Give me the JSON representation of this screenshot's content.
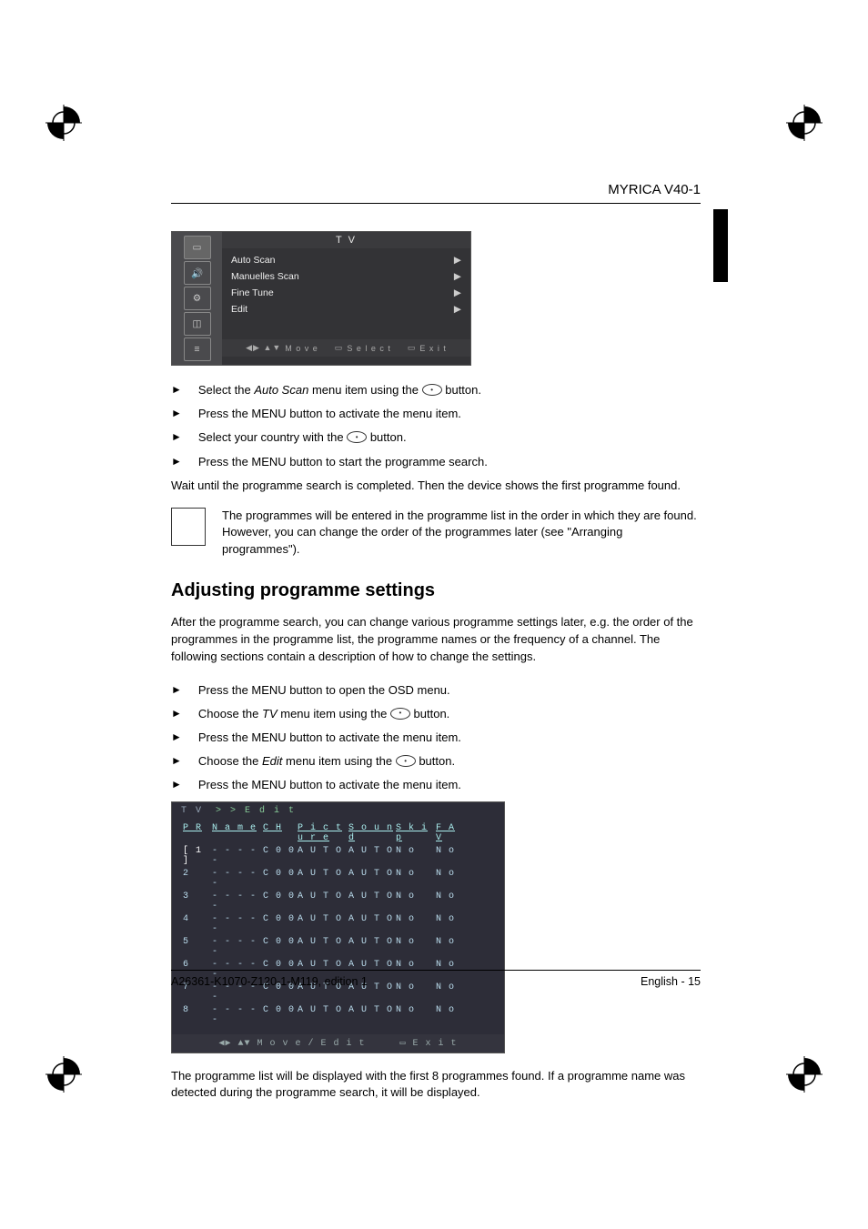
{
  "header": {
    "model": "MYRICA V40-1"
  },
  "osd_tv": {
    "title": "T V",
    "items": [
      {
        "label": "Auto Scan"
      },
      {
        "label": "Manuelles Scan"
      },
      {
        "label": "Fine Tune"
      },
      {
        "label": "Edit"
      }
    ],
    "footer": {
      "move": "M o v e",
      "select": "S e l e c t",
      "exit": "E x i t"
    }
  },
  "steps1": [
    {
      "pre": "Select the ",
      "em": "Auto Scan",
      "post": " menu item using the ",
      "oval": true,
      "tail": " button."
    },
    {
      "pre": "Press the MENU button to activate the menu item."
    },
    {
      "pre": "Select your country with the ",
      "oval": true,
      "tail": " button."
    },
    {
      "pre": "Press the MENU button to start the programme search."
    }
  ],
  "wait_text": "Wait until the programme search is completed. Then the device shows the first programme found.",
  "note_text": "The programmes will be entered in the programme list in the order in which they are found. However, you can change the order of the programmes later (see \"Arranging programmes\").",
  "section_title": "Adjusting programme settings",
  "section_intro": "After the programme search, you can change various programme settings later, e.g. the order of the programmes in the programme list, the programme names or the frequency of a channel. The following sections contain a description of how to change the settings.",
  "steps2": [
    {
      "pre": "Press the MENU button to open the OSD menu."
    },
    {
      "pre": "Choose the ",
      "em": "TV",
      "post": " menu item using the ",
      "oval": true,
      "tail": " button."
    },
    {
      "pre": "Press the MENU button to activate the menu item."
    },
    {
      "pre": "Choose the ",
      "em": "Edit",
      "post": " menu item using the ",
      "oval": true,
      "tail": " button."
    },
    {
      "pre": "Press the MENU button to activate the menu item."
    }
  ],
  "osd_edit": {
    "head1": "T V",
    "head2": "> >  E d i t",
    "columns": [
      "P R",
      "N a m e",
      "C H",
      "P i c t u r e",
      "S o u n d",
      "S k i p",
      "F A V"
    ],
    "rows": [
      {
        "pr": "[ 1 ]",
        "name": "- - - - -",
        "ch": "C 0 0",
        "pic": "A U T O",
        "snd": "A U T O",
        "skip": "N o",
        "fav": "N o",
        "sel": true
      },
      {
        "pr": "2",
        "name": "- - - - -",
        "ch": "C 0 0",
        "pic": "A U T O",
        "snd": "A U T O",
        "skip": "N o",
        "fav": "N o"
      },
      {
        "pr": "3",
        "name": "- - - - -",
        "ch": "C 0 0",
        "pic": "A U T O",
        "snd": "A U T O",
        "skip": "N o",
        "fav": "N o"
      },
      {
        "pr": "4",
        "name": "- - - - -",
        "ch": "C 0 0",
        "pic": "A U T O",
        "snd": "A U T O",
        "skip": "N o",
        "fav": "N o"
      },
      {
        "pr": "5",
        "name": "- - - - -",
        "ch": "C 0 0",
        "pic": "A U T O",
        "snd": "A U T O",
        "skip": "N o",
        "fav": "N o"
      },
      {
        "pr": "6",
        "name": "- - - - -",
        "ch": "C 0 0",
        "pic": "A U T O",
        "snd": "A U T O",
        "skip": "N o",
        "fav": "N o"
      },
      {
        "pr": "7",
        "name": "- - - - -",
        "ch": "C 0 0",
        "pic": "A U T O",
        "snd": "A U T O",
        "skip": "N o",
        "fav": "N o"
      },
      {
        "pr": "8",
        "name": "- - - - -",
        "ch": "C 0 0",
        "pic": "A U T O",
        "snd": "A U T O",
        "skip": "N o",
        "fav": "N o"
      }
    ],
    "footer": {
      "move": "M o v e / E d i t",
      "exit": "E x i t"
    }
  },
  "after_table": "The programme list will be displayed with the first 8 programmes found. If a programme name was detected during the programme search, it will be displayed.",
  "footer": {
    "left": "A26361-K1070-Z120-1-M119, edition 1",
    "right": "English - 15"
  }
}
